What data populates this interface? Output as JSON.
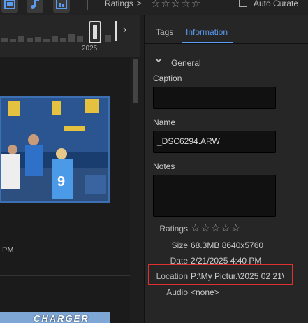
{
  "toolbar": {
    "ratings_label": "Ratings",
    "ratings_operator": "≥",
    "filter_stars": [
      "☆",
      "☆",
      "☆",
      "☆",
      "☆"
    ],
    "auto_curate_label": "Auto Curate",
    "auto_curate_checked": false,
    "view_buttons": [
      "film-icon",
      "music-icon",
      "chart-icon"
    ]
  },
  "timeline": {
    "year_label": "2025"
  },
  "grid": {
    "photo1_timestamp": "PM",
    "photo2_text": "CHARGER"
  },
  "panel": {
    "tabs": [
      {
        "label": "Tags",
        "active": false
      },
      {
        "label": "Information",
        "active": true
      }
    ],
    "section_title": "General",
    "caption": {
      "label": "Caption",
      "value": ""
    },
    "name": {
      "label": "Name",
      "value": "_DSC6294.ARW"
    },
    "notes": {
      "label": "Notes",
      "value": ""
    },
    "ratings": {
      "label": "Ratings",
      "stars": [
        "☆",
        "☆",
        "☆",
        "☆",
        "☆"
      ]
    },
    "size": {
      "label": "Size",
      "value": "68.3MB  8640x5760"
    },
    "date": {
      "label": "Date",
      "value": "2/21/2025 4:40 PM"
    },
    "location": {
      "label": "Location",
      "value": "P:\\My Pictur.\\2025 02 21\\"
    },
    "audio": {
      "label": "Audio",
      "value": "<none>"
    }
  },
  "colors": {
    "accent": "#5b9bf0",
    "highlight": "#e0302f",
    "selection_border": "#3d6fb3"
  }
}
